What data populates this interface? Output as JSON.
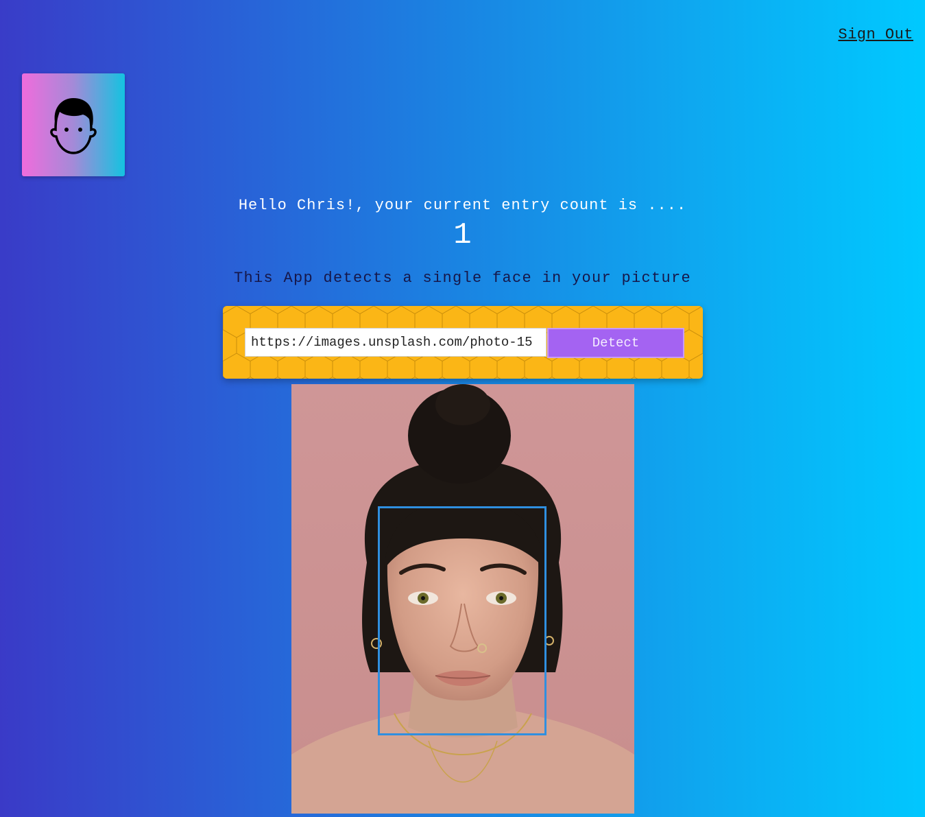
{
  "nav": {
    "sign_out_label": "Sign Out"
  },
  "logo": {
    "icon": "face-outline-icon"
  },
  "rank": {
    "greeting": "Hello Chris!, your current entry count is ....",
    "entry_count": "1"
  },
  "intro": {
    "description": "This App detects a single face in your picture"
  },
  "image_form": {
    "url_value": "https://images.unsplash.com/photo-15",
    "detect_label": "Detect"
  },
  "colors": {
    "form_background": "#fbb616",
    "detect_button": "#a463f2",
    "face_box_border": "#2f8fe0"
  }
}
